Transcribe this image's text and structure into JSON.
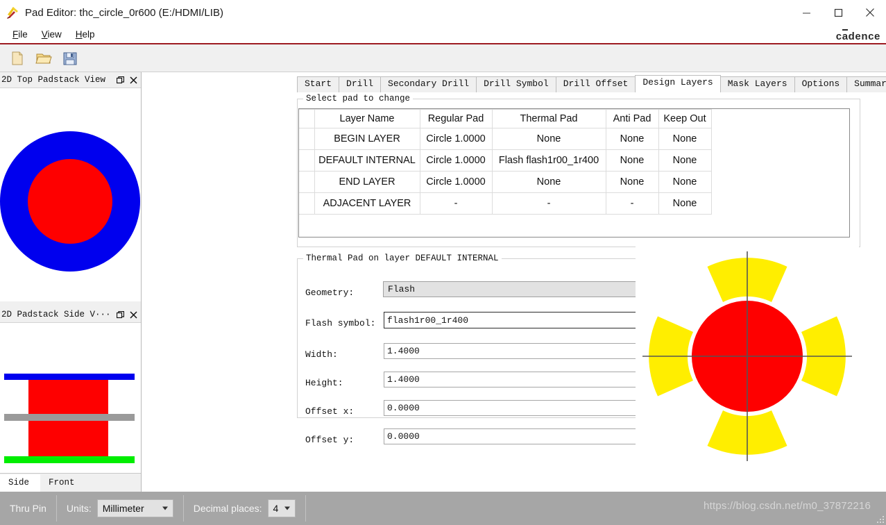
{
  "window": {
    "title": "Pad Editor: thc_circle_0r600  (E:/HDMI/LIB)",
    "app_icon": "cadence-padeditor-icon",
    "minimize": "minimize-icon",
    "maximize": "maximize-icon",
    "close": "close-icon",
    "brand": "cadence"
  },
  "menu": {
    "items": [
      {
        "label": "File",
        "mnemonic": "F"
      },
      {
        "label": "View",
        "mnemonic": "V"
      },
      {
        "label": "Help",
        "mnemonic": "H"
      }
    ]
  },
  "toolbar": {
    "buttons": [
      {
        "name": "new-file-button",
        "icon": "new-document-icon"
      },
      {
        "name": "open-file-button",
        "icon": "open-folder-icon"
      },
      {
        "name": "save-file-button",
        "icon": "floppy-save-icon"
      }
    ]
  },
  "left_dock": {
    "top_panel": {
      "title": "2D Top Padstack View",
      "float_button": "restore-icon",
      "close_button": "close-icon",
      "graphic": {
        "outer_color": "#0000ee",
        "inner_color": "#fe0000"
      }
    },
    "side_panel": {
      "title": "2D Padstack Side V···",
      "float_button": "restore-icon",
      "close_button": "close-icon",
      "graphic": {
        "top_layer_color": "#0000ee",
        "mid_layer_color": "#9a9a9a",
        "bottom_layer_color": "#00ee00",
        "barrel_color": "#fe0000"
      },
      "tabs": [
        {
          "label": "Side",
          "active": true
        },
        {
          "label": "Front",
          "active": false
        }
      ]
    }
  },
  "tabs": [
    {
      "label": "Start",
      "active": false
    },
    {
      "label": "Drill",
      "active": false
    },
    {
      "label": "Secondary Drill",
      "active": false
    },
    {
      "label": "Drill Symbol",
      "active": false
    },
    {
      "label": "Drill Offset",
      "active": false
    },
    {
      "label": "Design Layers",
      "active": true
    },
    {
      "label": "Mask Layers",
      "active": false
    },
    {
      "label": "Options",
      "active": false
    },
    {
      "label": "Summary",
      "active": false
    }
  ],
  "select_pad_group": {
    "title": "Select pad to change",
    "table": {
      "headers": [
        "",
        "Layer Name",
        "Regular Pad",
        "Thermal Pad",
        "Anti Pad",
        "Keep Out"
      ],
      "rows": [
        {
          "layer_name": "BEGIN LAYER",
          "dim": false,
          "regular_pad": "Circle 1.0000",
          "thermal_pad": "None",
          "thermal_highlight": false,
          "anti_pad": "None",
          "keep_out": "None"
        },
        {
          "layer_name": "DEFAULT INTERNAL",
          "dim": true,
          "regular_pad": "Circle 1.0000",
          "thermal_pad": "Flash flash1r00_1r400",
          "thermal_highlight": true,
          "anti_pad": "None",
          "keep_out": "None"
        },
        {
          "layer_name": "END LAYER",
          "dim": false,
          "regular_pad": "Circle 1.0000",
          "thermal_pad": "None",
          "thermal_highlight": false,
          "anti_pad": "None",
          "keep_out": "None"
        },
        {
          "layer_name": "ADJACENT LAYER",
          "dim": true,
          "regular_pad": "-",
          "thermal_pad": "-",
          "thermal_highlight": false,
          "anti_pad": "-",
          "keep_out": "None"
        }
      ]
    }
  },
  "thermal_pad_group": {
    "title": "Thermal Pad on layer DEFAULT INTERNAL",
    "fields": {
      "geometry_label": "Geometry:",
      "geometry_value": "Flash",
      "flash_symbol_label": "Flash symbol:",
      "flash_symbol_value": "flash1r00_1r400",
      "browse_label": "...",
      "width_label": "Width:",
      "width_value": "1.4000",
      "height_label": "Height:",
      "height_value": "1.4000",
      "offset_x_label": "Offset x:",
      "offset_x_value": "0.0000",
      "offset_y_label": "Offset y:",
      "offset_y_value": "0.0000"
    }
  },
  "preview": {
    "name": "thermal-pad-preview",
    "pad_color": "#fe0000",
    "spoke_color": "#ffee00",
    "crosshair_color": "#555555"
  },
  "statusbar": {
    "pin_type": "Thru Pin",
    "units_label": "Units:",
    "units_value": "Millimeter",
    "decimals_label": "Decimal places:",
    "decimals_value": "4",
    "watermark": "https://blog.csdn.net/m0_37872216"
  }
}
